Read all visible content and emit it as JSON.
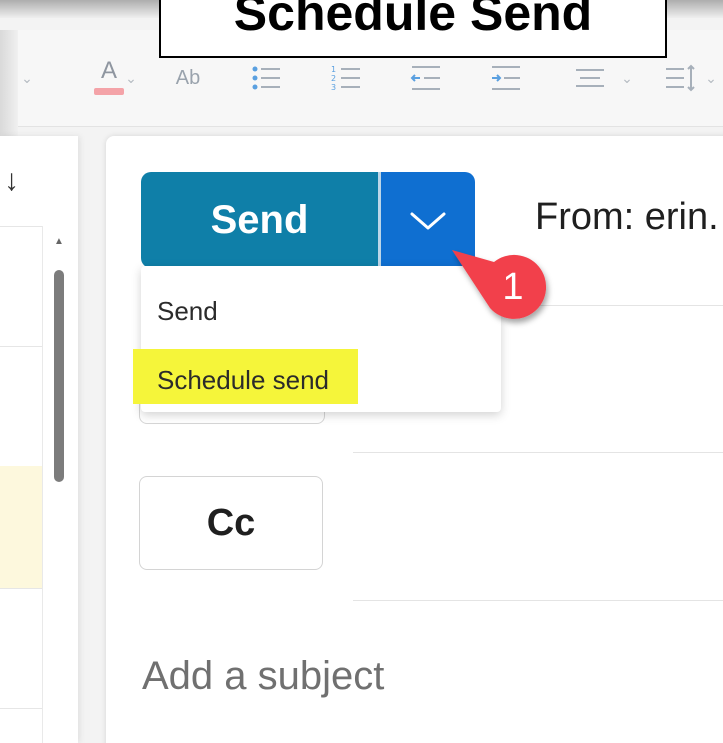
{
  "caption": {
    "text": "Schedule Send"
  },
  "toolbar": {
    "icons": [
      "font-color-icon",
      "clear-formatting-icon",
      "bullets-icon",
      "numbering-icon",
      "decrease-indent-icon",
      "increase-indent-icon",
      "align-icon",
      "line-spacing-icon"
    ],
    "font_color_glyph": "A",
    "clear_formatting_glyph": "Ab",
    "accent_color": "#f4a3a8"
  },
  "message_list": {
    "sort_glyph": "↓"
  },
  "compose": {
    "send_label": "Send",
    "from_label": "From: erin.",
    "cc_label": "Cc",
    "subject_placeholder": "Add a subject"
  },
  "send_menu": {
    "items": [
      {
        "label": "Send"
      },
      {
        "label": "Schedule send",
        "highlighted": true
      }
    ],
    "highlight_color": "#f5f53a"
  },
  "annotation": {
    "step_number": "1",
    "color": "#f2414b"
  },
  "colors": {
    "send_button": "#0f7fa8",
    "send_dropdown": "#0f6fd1"
  }
}
